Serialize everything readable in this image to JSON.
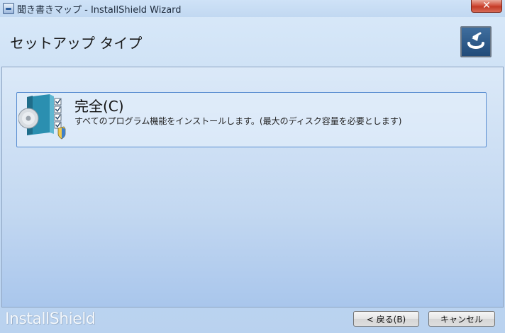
{
  "window": {
    "title": "聞き書きマップ - InstallShield Wizard",
    "close_glyph": "✕"
  },
  "header": {
    "title": "セットアップ タイプ"
  },
  "option": {
    "title": "完全(C)",
    "description": "すべてのプログラム機能をインストールします。(最大のディスク容量を必要とします)",
    "icon": "install-disc-icon"
  },
  "footer": {
    "brand": "InstallShield",
    "back_label": "< 戻る(B)",
    "cancel_label": "キャンセル"
  },
  "colors": {
    "accent": "#5a8ed1",
    "close_red": "#c33a26"
  }
}
